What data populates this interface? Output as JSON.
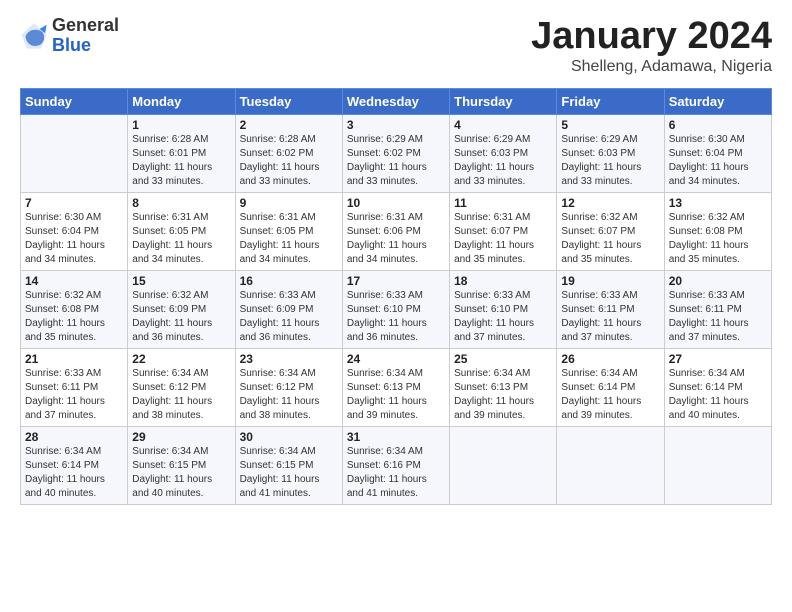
{
  "header": {
    "logo_general": "General",
    "logo_blue": "Blue",
    "month_title": "January 2024",
    "location": "Shelleng, Adamawa, Nigeria"
  },
  "days_of_week": [
    "Sunday",
    "Monday",
    "Tuesday",
    "Wednesday",
    "Thursday",
    "Friday",
    "Saturday"
  ],
  "weeks": [
    [
      {
        "day": "",
        "detail": ""
      },
      {
        "day": "1",
        "detail": "Sunrise: 6:28 AM\nSunset: 6:01 PM\nDaylight: 11 hours\nand 33 minutes."
      },
      {
        "day": "2",
        "detail": "Sunrise: 6:28 AM\nSunset: 6:02 PM\nDaylight: 11 hours\nand 33 minutes."
      },
      {
        "day": "3",
        "detail": "Sunrise: 6:29 AM\nSunset: 6:02 PM\nDaylight: 11 hours\nand 33 minutes."
      },
      {
        "day": "4",
        "detail": "Sunrise: 6:29 AM\nSunset: 6:03 PM\nDaylight: 11 hours\nand 33 minutes."
      },
      {
        "day": "5",
        "detail": "Sunrise: 6:29 AM\nSunset: 6:03 PM\nDaylight: 11 hours\nand 33 minutes."
      },
      {
        "day": "6",
        "detail": "Sunrise: 6:30 AM\nSunset: 6:04 PM\nDaylight: 11 hours\nand 34 minutes."
      }
    ],
    [
      {
        "day": "7",
        "detail": "Sunrise: 6:30 AM\nSunset: 6:04 PM\nDaylight: 11 hours\nand 34 minutes."
      },
      {
        "day": "8",
        "detail": "Sunrise: 6:31 AM\nSunset: 6:05 PM\nDaylight: 11 hours\nand 34 minutes."
      },
      {
        "day": "9",
        "detail": "Sunrise: 6:31 AM\nSunset: 6:05 PM\nDaylight: 11 hours\nand 34 minutes."
      },
      {
        "day": "10",
        "detail": "Sunrise: 6:31 AM\nSunset: 6:06 PM\nDaylight: 11 hours\nand 34 minutes."
      },
      {
        "day": "11",
        "detail": "Sunrise: 6:31 AM\nSunset: 6:07 PM\nDaylight: 11 hours\nand 35 minutes."
      },
      {
        "day": "12",
        "detail": "Sunrise: 6:32 AM\nSunset: 6:07 PM\nDaylight: 11 hours\nand 35 minutes."
      },
      {
        "day": "13",
        "detail": "Sunrise: 6:32 AM\nSunset: 6:08 PM\nDaylight: 11 hours\nand 35 minutes."
      }
    ],
    [
      {
        "day": "14",
        "detail": "Sunrise: 6:32 AM\nSunset: 6:08 PM\nDaylight: 11 hours\nand 35 minutes."
      },
      {
        "day": "15",
        "detail": "Sunrise: 6:32 AM\nSunset: 6:09 PM\nDaylight: 11 hours\nand 36 minutes."
      },
      {
        "day": "16",
        "detail": "Sunrise: 6:33 AM\nSunset: 6:09 PM\nDaylight: 11 hours\nand 36 minutes."
      },
      {
        "day": "17",
        "detail": "Sunrise: 6:33 AM\nSunset: 6:10 PM\nDaylight: 11 hours\nand 36 minutes."
      },
      {
        "day": "18",
        "detail": "Sunrise: 6:33 AM\nSunset: 6:10 PM\nDaylight: 11 hours\nand 37 minutes."
      },
      {
        "day": "19",
        "detail": "Sunrise: 6:33 AM\nSunset: 6:11 PM\nDaylight: 11 hours\nand 37 minutes."
      },
      {
        "day": "20",
        "detail": "Sunrise: 6:33 AM\nSunset: 6:11 PM\nDaylight: 11 hours\nand 37 minutes."
      }
    ],
    [
      {
        "day": "21",
        "detail": "Sunrise: 6:33 AM\nSunset: 6:11 PM\nDaylight: 11 hours\nand 37 minutes."
      },
      {
        "day": "22",
        "detail": "Sunrise: 6:34 AM\nSunset: 6:12 PM\nDaylight: 11 hours\nand 38 minutes."
      },
      {
        "day": "23",
        "detail": "Sunrise: 6:34 AM\nSunset: 6:12 PM\nDaylight: 11 hours\nand 38 minutes."
      },
      {
        "day": "24",
        "detail": "Sunrise: 6:34 AM\nSunset: 6:13 PM\nDaylight: 11 hours\nand 39 minutes."
      },
      {
        "day": "25",
        "detail": "Sunrise: 6:34 AM\nSunset: 6:13 PM\nDaylight: 11 hours\nand 39 minutes."
      },
      {
        "day": "26",
        "detail": "Sunrise: 6:34 AM\nSunset: 6:14 PM\nDaylight: 11 hours\nand 39 minutes."
      },
      {
        "day": "27",
        "detail": "Sunrise: 6:34 AM\nSunset: 6:14 PM\nDaylight: 11 hours\nand 40 minutes."
      }
    ],
    [
      {
        "day": "28",
        "detail": "Sunrise: 6:34 AM\nSunset: 6:14 PM\nDaylight: 11 hours\nand 40 minutes."
      },
      {
        "day": "29",
        "detail": "Sunrise: 6:34 AM\nSunset: 6:15 PM\nDaylight: 11 hours\nand 40 minutes."
      },
      {
        "day": "30",
        "detail": "Sunrise: 6:34 AM\nSunset: 6:15 PM\nDaylight: 11 hours\nand 41 minutes."
      },
      {
        "day": "31",
        "detail": "Sunrise: 6:34 AM\nSunset: 6:16 PM\nDaylight: 11 hours\nand 41 minutes."
      },
      {
        "day": "",
        "detail": ""
      },
      {
        "day": "",
        "detail": ""
      },
      {
        "day": "",
        "detail": ""
      }
    ]
  ]
}
